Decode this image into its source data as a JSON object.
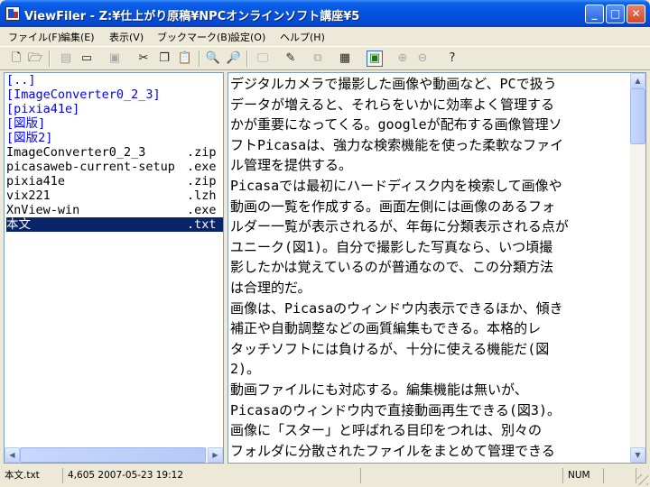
{
  "window": {
    "title": "ViewFiler - Z:¥仕上がり原稿¥NPCオンラインソフト講座¥5",
    "controls": {
      "minimize": "_",
      "maximize": "□",
      "close": "✕"
    }
  },
  "menu": [
    "ファイル(F)",
    "編集(E)",
    "表示(V)",
    "ブックマーク(B)",
    "設定(O)",
    "ヘルプ(H)"
  ],
  "toolbar": {
    "icons": [
      "new-file-icon",
      "open-folder-icon",
      "list-icon",
      "folder-icon",
      "folder-up-icon",
      "cut-icon",
      "copy-icon",
      "paste-icon",
      "search-icon",
      "search-next-icon",
      "monitor-icon",
      "edit-icon",
      "duplicate-icon",
      "grid-icon",
      "view-icon",
      "zoom-in-icon",
      "zoom-out-icon",
      "help-icon"
    ]
  },
  "files": [
    {
      "name": "[..]",
      "ext": "",
      "type": "dir"
    },
    {
      "name": "[ImageConverter0_2_3]",
      "ext": "",
      "type": "dir"
    },
    {
      "name": "[pixia41e]",
      "ext": "",
      "type": "dir"
    },
    {
      "name": "[図版]",
      "ext": "",
      "type": "dir"
    },
    {
      "name": "[図版2]",
      "ext": "",
      "type": "dir"
    },
    {
      "name": "ImageConverter0_2_3",
      "ext": ".zip",
      "type": "file"
    },
    {
      "name": "picasaweb-current-setup",
      "ext": ".exe",
      "type": "file"
    },
    {
      "name": "pixia41e",
      "ext": ".zip",
      "type": "file"
    },
    {
      "name": "vix221",
      "ext": ".lzh",
      "type": "file"
    },
    {
      "name": "XnView-win",
      "ext": ".exe",
      "type": "file"
    },
    {
      "name": "本文",
      "ext": ".txt",
      "type": "selected"
    }
  ],
  "content_lines": [
    "デジタルカメラで撮影した画像や動画など、PCで扱う",
    "データが増えると、それらをいかに効率よく管理する",
    "かが重要になってくる。googleが配布する画像管理ソ",
    "フトPicasaは、強力な検索機能を使った柔軟なファイ",
    "ル管理を提供する。",
    "Picasaでは最初にハードディスク内を検索して画像や",
    "動画の一覧を作成する。画面左側には画像のあるフォ",
    "ルダー一覧が表示されるが、年毎に分類表示される点が",
    "ユニーク(図1)。自分で撮影した写真なら、いつ頃撮",
    "影したかは覚えているのが普通なので、この分類方法",
    "は合理的だ。",
    "画像は、Picasaのウィンドウ内表示できるほか、傾き",
    "補正や自動調整などの画質編集もできる。本格的レ",
    "タッチソフトには負けるが、十分に使える機能だ(図",
    "2)。",
    "動画ファイルにも対応する。編集機能は無いが、",
    "Picasaのウィンドウ内で直接動画再生できる(図3)。",
    "画像に「スター」と呼ばれる目印をつれは、別々の",
    "フォルダに分散されたファイルをまとめて管理できる"
  ],
  "status": {
    "filename": "本文.txt",
    "info": "4,605 2007-05-23 19:12",
    "num": "NUM"
  }
}
